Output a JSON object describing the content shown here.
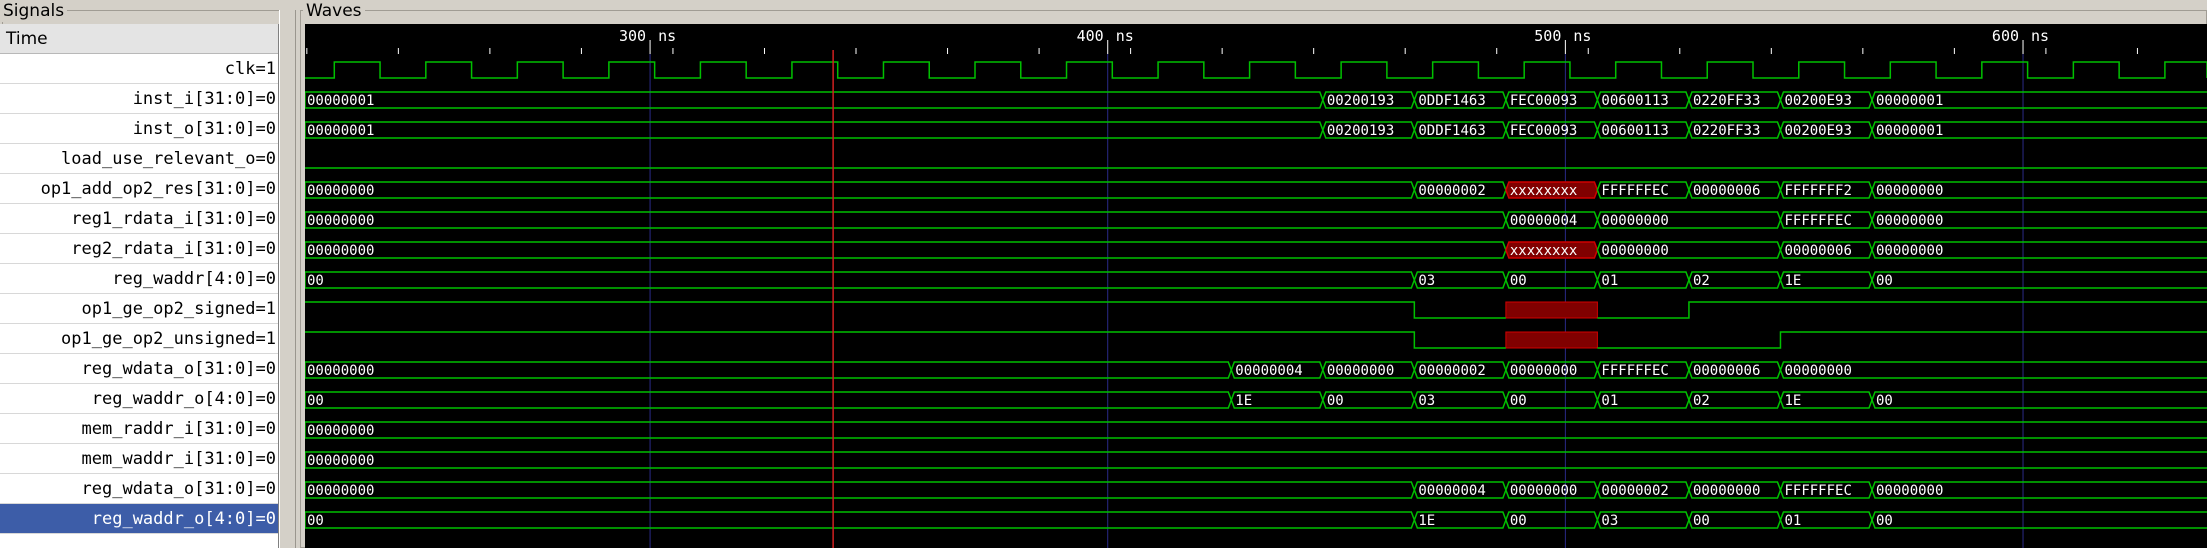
{
  "panes": {
    "signals_title": "Signals",
    "waves_title": "Waves"
  },
  "time_header_label": "Time",
  "timescale": {
    "ticks": [
      {
        "label": "300 ns",
        "time": 300
      },
      {
        "label": "400 ns",
        "time": 400
      },
      {
        "label": "500 ns",
        "time": 500
      },
      {
        "label": "600 ns",
        "time": 600
      }
    ],
    "view_start_ns": 224.6,
    "view_end_ns": 640.2,
    "clock_period_ns": 20,
    "clock_first_rise_ns": 231,
    "marker_ns": 340
  },
  "colors": {
    "wave": "#00c000",
    "undefined_fill": "#800000",
    "undefined_stroke": "#d00000",
    "grid": "#2a2a88",
    "marker": "#d02020",
    "value_text": "#ffffff",
    "tick_text": "#ffffff"
  },
  "signals": [
    {
      "name": "clk",
      "value_suffix": "=1",
      "kind": "clock"
    },
    {
      "name": "inst_i[31:0]",
      "value_suffix": "=0",
      "kind": "bus",
      "segments": [
        {
          "t": 224.6,
          "v": "00000001"
        },
        {
          "t": 447,
          "v": "00200193"
        },
        {
          "t": 467,
          "v": "0DDF1463"
        },
        {
          "t": 487,
          "v": "FEC00093"
        },
        {
          "t": 507,
          "v": "00600113"
        },
        {
          "t": 527,
          "v": "0220FF33"
        },
        {
          "t": 547,
          "v": "00200E93"
        },
        {
          "t": 567,
          "v": "00000001"
        }
      ]
    },
    {
      "name": "inst_o[31:0]",
      "value_suffix": "=0",
      "kind": "bus",
      "segments": [
        {
          "t": 224.6,
          "v": "00000001"
        },
        {
          "t": 447,
          "v": "00200193"
        },
        {
          "t": 467,
          "v": "0DDF1463"
        },
        {
          "t": 487,
          "v": "FEC00093"
        },
        {
          "t": 507,
          "v": "00600113"
        },
        {
          "t": 527,
          "v": "0220FF33"
        },
        {
          "t": 547,
          "v": "00200E93"
        },
        {
          "t": 567,
          "v": "00000001"
        }
      ]
    },
    {
      "name": "load_use_relevant_o",
      "value_suffix": "=0",
      "kind": "bit",
      "levels": [
        {
          "t": 224.6,
          "v": 0
        }
      ]
    },
    {
      "name": "op1_add_op2_res[31:0]",
      "value_suffix": "=0",
      "kind": "bus",
      "segments": [
        {
          "t": 224.6,
          "v": "00000000"
        },
        {
          "t": 467,
          "v": "00000002"
        },
        {
          "t": 487,
          "v": "xxxxxxxx",
          "x": true
        },
        {
          "t": 507,
          "v": "FFFFFFEC"
        },
        {
          "t": 527,
          "v": "00000006"
        },
        {
          "t": 547,
          "v": "FFFFFFF2"
        },
        {
          "t": 567,
          "v": "00000000"
        }
      ]
    },
    {
      "name": "reg1_rdata_i[31:0]",
      "value_suffix": "=0",
      "kind": "bus",
      "segments": [
        {
          "t": 224.6,
          "v": "00000000"
        },
        {
          "t": 487,
          "v": "00000004"
        },
        {
          "t": 507,
          "v": "00000000"
        },
        {
          "t": 547,
          "v": "FFFFFFEC"
        },
        {
          "t": 567,
          "v": "00000000"
        }
      ]
    },
    {
      "name": "reg2_rdata_i[31:0]",
      "value_suffix": "=0",
      "kind": "bus",
      "segments": [
        {
          "t": 224.6,
          "v": "00000000"
        },
        {
          "t": 487,
          "v": "xxxxxxxx",
          "x": true
        },
        {
          "t": 507,
          "v": "00000000"
        },
        {
          "t": 547,
          "v": "00000006"
        },
        {
          "t": 567,
          "v": "00000000"
        }
      ]
    },
    {
      "name": "reg_waddr[4:0]",
      "value_suffix": "=0",
      "kind": "bus",
      "segments": [
        {
          "t": 224.6,
          "v": "00"
        },
        {
          "t": 467,
          "v": "03"
        },
        {
          "t": 487,
          "v": "00"
        },
        {
          "t": 507,
          "v": "01"
        },
        {
          "t": 527,
          "v": "02"
        },
        {
          "t": 547,
          "v": "1E"
        },
        {
          "t": 567,
          "v": "00"
        }
      ]
    },
    {
      "name": "op1_ge_op2_signed",
      "value_suffix": "=1",
      "kind": "bit",
      "levels": [
        {
          "t": 224.6,
          "v": 1
        },
        {
          "t": 467,
          "v": 0
        },
        {
          "t": 487,
          "v": "x"
        },
        {
          "t": 507,
          "v": 0
        },
        {
          "t": 527,
          "v": 1
        }
      ]
    },
    {
      "name": "op1_ge_op2_unsigned",
      "value_suffix": "=1",
      "kind": "bit",
      "levels": [
        {
          "t": 224.6,
          "v": 1
        },
        {
          "t": 467,
          "v": 0
        },
        {
          "t": 487,
          "v": "x"
        },
        {
          "t": 507,
          "v": 0
        },
        {
          "t": 547,
          "v": 1
        }
      ]
    },
    {
      "name": "reg_wdata_o[31:0]",
      "value_suffix": "=0",
      "kind": "bus",
      "segments": [
        {
          "t": 224.6,
          "v": "00000000"
        },
        {
          "t": 427,
          "v": "00000004"
        },
        {
          "t": 447,
          "v": "00000000"
        },
        {
          "t": 467,
          "v": "00000002"
        },
        {
          "t": 487,
          "v": "00000000"
        },
        {
          "t": 507,
          "v": "FFFFFFEC"
        },
        {
          "t": 527,
          "v": "00000006"
        },
        {
          "t": 547,
          "v": "00000000"
        }
      ]
    },
    {
      "name": "reg_waddr_o[4:0]",
      "value_suffix": "=0",
      "kind": "bus",
      "segments": [
        {
          "t": 224.6,
          "v": "00"
        },
        {
          "t": 427,
          "v": "1E"
        },
        {
          "t": 447,
          "v": "00"
        },
        {
          "t": 467,
          "v": "03"
        },
        {
          "t": 487,
          "v": "00"
        },
        {
          "t": 507,
          "v": "01"
        },
        {
          "t": 527,
          "v": "02"
        },
        {
          "t": 547,
          "v": "1E"
        },
        {
          "t": 567,
          "v": "00"
        }
      ]
    },
    {
      "name": "mem_raddr_i[31:0]",
      "value_suffix": "=0",
      "kind": "bus",
      "segments": [
        {
          "t": 224.6,
          "v": "00000000"
        }
      ]
    },
    {
      "name": "mem_waddr_i[31:0]",
      "value_suffix": "=0",
      "kind": "bus",
      "segments": [
        {
          "t": 224.6,
          "v": "00000000"
        }
      ]
    },
    {
      "name": "reg_wdata_o[31:0]",
      "value_suffix": "=0",
      "kind": "bus",
      "segments": [
        {
          "t": 224.6,
          "v": "00000000"
        },
        {
          "t": 467,
          "v": "00000004"
        },
        {
          "t": 487,
          "v": "00000000"
        },
        {
          "t": 507,
          "v": "00000002"
        },
        {
          "t": 527,
          "v": "00000000"
        },
        {
          "t": 547,
          "v": "FFFFFFEC"
        },
        {
          "t": 567,
          "v": "00000000"
        }
      ]
    },
    {
      "name": "reg_waddr_o[4:0]",
      "value_suffix": "=0",
      "kind": "bus",
      "selected": true,
      "segments": [
        {
          "t": 224.6,
          "v": "00"
        },
        {
          "t": 467,
          "v": "1E"
        },
        {
          "t": 487,
          "v": "00"
        },
        {
          "t": 507,
          "v": "03"
        },
        {
          "t": 527,
          "v": "00"
        },
        {
          "t": 547,
          "v": "01"
        },
        {
          "t": 567,
          "v": "00"
        }
      ]
    }
  ]
}
